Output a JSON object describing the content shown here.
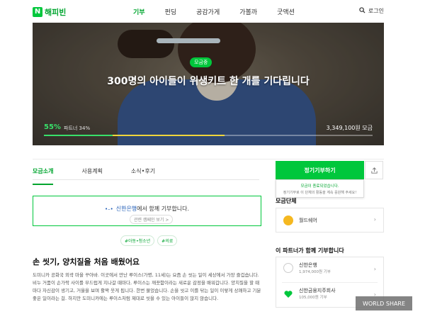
{
  "header": {
    "logo_text": "해피빈",
    "logo_mark": "N",
    "nav": [
      "기부",
      "펀딩",
      "공감가게",
      "가볼까",
      "굿액션"
    ],
    "active_nav": "기부",
    "login_label": "로그인"
  },
  "hero": {
    "tag": "모금중",
    "title": "300명의 아이들이 위생키트 한 개를 기다립니다",
    "progress_percent_label": "55%",
    "progress_percent": 55,
    "partner_label": "파트너 34%",
    "partner_percent": 34,
    "amount": "3,349,100원 모금"
  },
  "tabs": [
    {
      "label": "모금소개",
      "active": true
    },
    {
      "label": "사용계획",
      "active": false
    },
    {
      "label": "소식•후기",
      "active": false
    }
  ],
  "sponsor": {
    "bank_name": "신한은행",
    "suffix": "에서 함께 기부합니다.",
    "more_label": "관련 캠페인 보기 >"
  },
  "hashtags": [
    "#아동•청소년",
    "#의료"
  ],
  "article": {
    "title": "손 씻기, 양치질을 처음 배웠어요",
    "body": "도미니카 공화국 외곽 마을 꾸아바. 이곳에서 만난 루이스(가명, 11세)는 요즘 손 씻는 일이 세상에서 가장 즐겁습니다. 비누 거품이 손가락 사이를 부드럽게 지나갈 때마다, 루이스는 깨끗함이라는 새로운 감정을 배워갑니다. 양치질을 할 때마다 자신감이 생기고, 거울을 보며 활짝 웃게 됩니다. 한번 물었습니다. 손을 씻고 이를 닦는 일이 이렇게 상쾌하고 기분 좋은 일이라는 걸. 하지만 도미니카에는 루이스처럼 제대로 씻을 수 있는 아이들이 많지 않습니다."
  },
  "donate": {
    "button_label": "정기기부하기",
    "tooltip_line1": "모금이 종료되었습니다.",
    "tooltip_line2": "정기기부로 이 단체의 활동을 계속 응원해 주세요!"
  },
  "organization": {
    "section_label": "모금단체",
    "name": "월드쉐어"
  },
  "partners": {
    "section_label": "이 파트너가 함께 기부합니다",
    "items": [
      {
        "name": "신한은행",
        "amount": "1,974,000원 기부"
      },
      {
        "name": "신한금융지주회사",
        "amount": "105,000원 기부"
      }
    ]
  },
  "watermark": "WORLD SHARE",
  "colors": {
    "brand_green": "#00c73c",
    "partner_yellow": "#f0d63b",
    "bank_blue": "#1e5bb5"
  }
}
